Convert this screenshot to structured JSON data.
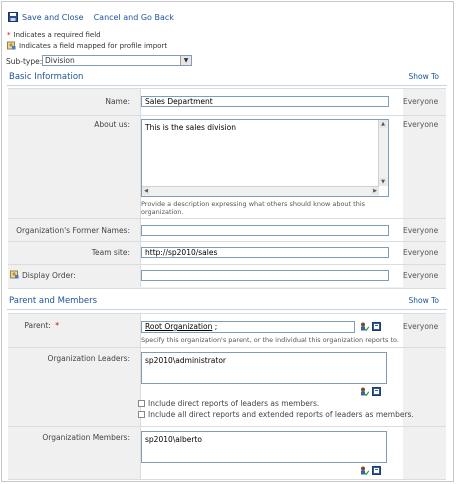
{
  "toolbar": {
    "save_close": "Save and Close",
    "cancel_back": "Cancel and Go Back"
  },
  "notes": {
    "required_marker": "*",
    "required": "Indicates a required field",
    "mapped": "Indicates a field mapped for profile import"
  },
  "subtype": {
    "label": "Sub-type:",
    "value": "Division"
  },
  "basic": {
    "title": "Basic Information",
    "show_to": "Show To",
    "name": {
      "label": "Name:",
      "value": "Sales Department",
      "privacy": "Everyone"
    },
    "about": {
      "label": "About us:",
      "value": "This is the sales division",
      "description": "Provide a description expressing what others should know about this organization.",
      "privacy": "Everyone"
    },
    "former_names": {
      "label": "Organization's Former Names:",
      "value": "",
      "privacy": "Everyone"
    },
    "team_site": {
      "label": "Team site:",
      "value": "http://sp2010/sales",
      "privacy": "Everyone"
    },
    "display_order": {
      "label": "Display Order:",
      "value": "",
      "privacy": "Everyone"
    }
  },
  "parent_members": {
    "title": "Parent and Members",
    "show_to": "Show To",
    "parent": {
      "label": "Parent:",
      "required_marker": "*",
      "value": "Root Organization",
      "suffix": ";",
      "description": "Specify this organization's parent, or the individual this organization reports to.",
      "privacy": "Everyone"
    },
    "leaders": {
      "label": "Organization Leaders:",
      "value": "sp2010\\administrator",
      "check1": "Include direct reports of leaders as members.",
      "check2": "Include all direct reports and extended reports of leaders as members."
    },
    "members": {
      "label": "Organization Members:",
      "value": "sp2010\\alberto"
    }
  },
  "colors": {
    "link": "#1d5398",
    "required": "#cc0000",
    "form_bg": "#f0f0f0"
  },
  "icons": [
    "save-icon",
    "mapped-field-icon",
    "check-names-icon",
    "browse-address-book-icon"
  ]
}
